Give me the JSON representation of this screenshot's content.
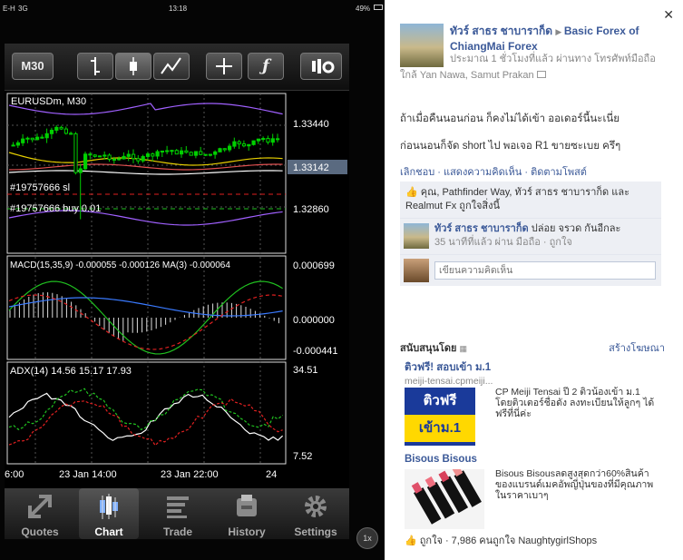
{
  "statusbar": {
    "carrier": "E-H",
    "network": "3G",
    "time": "13:18",
    "battery": "49%"
  },
  "toolbar": {
    "timeframe": "M30"
  },
  "chart": {
    "symbol_label": "EURUSDm, M30",
    "price_levels": [
      "1.33440",
      "1.33142",
      "1.32860"
    ],
    "order_labels": [
      "#19757666 sl",
      "#19757666 buy 0.01"
    ],
    "macd_label": "MACD(15,35,9) -0.000055 -0.000126 MA(3) -0.000064",
    "macd_levels": [
      "0.000699",
      "0.000000",
      "-0.000441"
    ],
    "adx_label": "ADX(14) 14.56 15.17 17.93",
    "adx_levels": [
      "34.51",
      "7.52"
    ],
    "time_labels": [
      "6:00",
      "23 Jan 14:00",
      "23 Jan 22:00",
      "24"
    ]
  },
  "tabs": [
    {
      "label": "Quotes",
      "icon": "quotes-icon"
    },
    {
      "label": "Chart",
      "icon": "chart-icon"
    },
    {
      "label": "Trade",
      "icon": "trade-icon"
    },
    {
      "label": "History",
      "icon": "history-icon"
    },
    {
      "label": "Settings",
      "icon": "settings-icon"
    }
  ],
  "zoom_label": "1x",
  "fb": {
    "author": "ทัวร์ สาธร ชาบาราก็ด",
    "target": "Basic Forex of ChiangMai Forex",
    "meta_line1": "ประมาณ 1 ชั่วโมงที่แล้ว ผ่านทาง โทรศัพท์มือถือ",
    "meta_line2": "ใกล้ Yan Nawa, Samut Prakan",
    "text1": "ถ้าเมื่อคืนนอนก่อน ก็คงไม่ได้เข้า ออเดอร์นี้นะเนี่ย",
    "text2": "ก่อนนอนก็จัด short ไป พอเจอ R1 ขายซะเบย ครึๆ",
    "actions": "เลิกชอบ · แสดงความคิดเห็น · ติดตามโพสต์",
    "likes": "คุณ, Pathfinder Way, ทัวร์ สาธร ชาบาราก็ด และ Realmut Fx ถูกใจสิ่งนี้",
    "comment_author": "ทัวร์ สาธร ชาบาราก็ด",
    "comment_text": "ปล่อย จรวด กันอีกละ",
    "comment_meta": "35 นาทีที่แล้ว ผ่าน มือถือ · ถูกใจ",
    "comment_placeholder": "เขียนความคิดเห็น",
    "sponsored": "สนับสนุนโดย",
    "create_ad": "สร้างโฆษณา",
    "ad1": {
      "title": "ติวฟรี! สอบเข้า ม.1",
      "url": "meiji-tensai.cpmeiji...",
      "body": "CP Meiji Tensai ปี 2 ติวน้องเข้า ม.1 โดยติวเตอร์ชื่อดัง ลงทะเบียนให้ลูกๆ ได้ฟรีที่นี่ค่ะ",
      "image_line1": "ติวฟรี",
      "image_line2": "เข้าม.1"
    },
    "ad2": {
      "title": "Bisous Bisous",
      "body": "Bisous Bisousลดสูงสุดกว่า60%สินค้าของแบรนด์เมคอัพญี่ปุ่นของที่มีคุณภาพในราคาเบาๆ"
    },
    "ad_footer": "ถูกใจ · 7,986 คนถูกใจ NaughtygirlShops"
  },
  "colors": {
    "chart_bg": "#000000",
    "fb_link": "#3b5998",
    "bull": "#00d000",
    "ma_yellow": "#e8d000",
    "band_purple": "#a060ff"
  }
}
